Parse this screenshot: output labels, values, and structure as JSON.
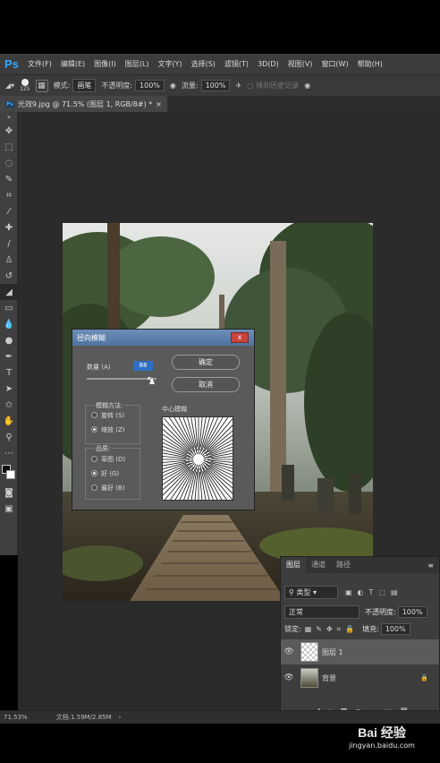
{
  "menubar": {
    "logo": "Ps",
    "items": [
      "文件(F)",
      "编辑(E)",
      "图像(I)",
      "图层(L)",
      "文字(Y)",
      "选择(S)",
      "滤镜(T)",
      "3D(D)",
      "视图(V)",
      "窗口(W)",
      "帮助(H)"
    ]
  },
  "options": {
    "brush_size": "125",
    "mode_label": "模式:",
    "mode_value": "画笔",
    "opacity_label": "不透明度:",
    "opacity_value": "100%",
    "flow_label": "流量:",
    "flow_value": "100%",
    "history_label": "抹到历史记录"
  },
  "document": {
    "tab_title": "光效9.jpg @ 71.5% (图层 1, RGB/8#) *",
    "tab_close": "×"
  },
  "statusbar": {
    "zoom": "71.53%",
    "doc_info": "文档:1.59M/2.85M"
  },
  "dialog": {
    "title": "径向模糊",
    "close": "x",
    "amount_label": "数量 (A)",
    "amount_value": "88",
    "ok_label": "确定",
    "cancel_label": "取消",
    "blur_method_label": "模糊方法:",
    "method_spin": "旋转 (S)",
    "method_zoom": "缩放 (Z)",
    "quality_label": "品质:",
    "quality_draft": "草图 (D)",
    "quality_good": "好 (G)",
    "quality_best": "最好 (B)",
    "center_label": "中心模糊"
  },
  "layers": {
    "tabs": [
      "图层",
      "通道",
      "路径"
    ],
    "filter_kind": "类型",
    "blend_mode": "正常",
    "opacity_label": "不透明度:",
    "opacity_value": "100%",
    "lock_label": "锁定:",
    "fill_label": "填充:",
    "fill_value": "100%",
    "items": [
      {
        "name": "图层 1"
      },
      {
        "name": "背景"
      }
    ]
  },
  "watermark": {
    "brand": "Bai 经验",
    "url": "jingyan.baidu.com"
  },
  "colors": {
    "ps_blue": "#31a8ff",
    "panel": "#3c3c3c",
    "dialog_title": "#5a7fae"
  }
}
